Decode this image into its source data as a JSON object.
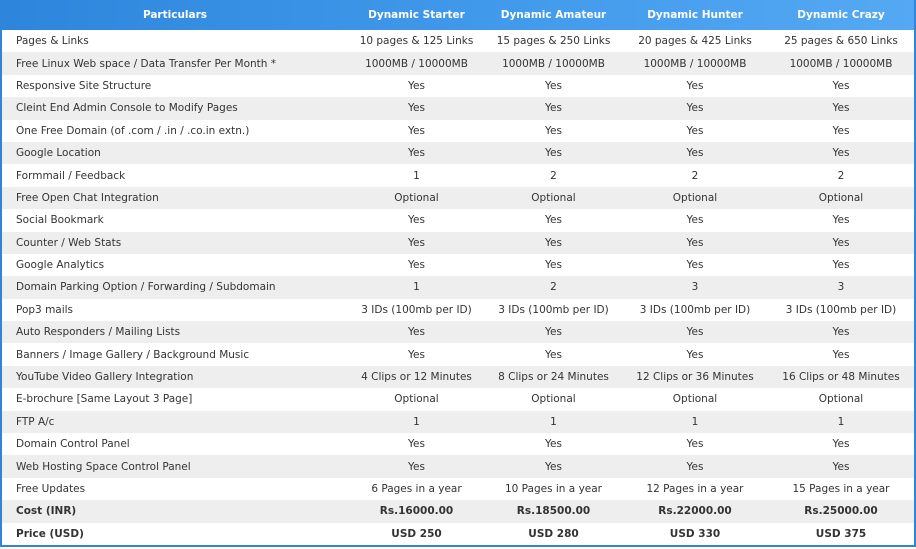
{
  "colors": {
    "header_bg": "#3a94e6",
    "border": "#2f86d9",
    "stripe": "#eeeeee"
  },
  "header": [
    "Particulars",
    "Dynamic Starter",
    "Dynamic Amateur",
    "Dynamic Hunter",
    "Dynamic Crazy"
  ],
  "rows": [
    {
      "label": "Pages & Links",
      "values": [
        "10 pages & 125 Links",
        "15 pages & 250 Links",
        "20 pages & 425 Links",
        "25 pages & 650 Links"
      ]
    },
    {
      "label": "Free Linux Web space / Data Transfer Per Month *",
      "values": [
        "1000MB / 10000MB",
        "1000MB / 10000MB",
        "1000MB / 10000MB",
        "1000MB / 10000MB"
      ]
    },
    {
      "label": "Responsive Site Structure",
      "values": [
        "Yes",
        "Yes",
        "Yes",
        "Yes"
      ]
    },
    {
      "label": "Cleint End Admin Console to Modify Pages",
      "values": [
        "Yes",
        "Yes",
        "Yes",
        "Yes"
      ]
    },
    {
      "label": "One Free Domain (of .com / .in / .co.in extn.)",
      "values": [
        "Yes",
        "Yes",
        "Yes",
        "Yes"
      ]
    },
    {
      "label": "Google Location",
      "values": [
        "Yes",
        "Yes",
        "Yes",
        "Yes"
      ]
    },
    {
      "label": "Formmail / Feedback",
      "values": [
        "1",
        "2",
        "2",
        "2"
      ]
    },
    {
      "label": "Free Open Chat Integration",
      "values": [
        "Optional",
        "Optional",
        "Optional",
        "Optional"
      ]
    },
    {
      "label": "Social Bookmark",
      "values": [
        "Yes",
        "Yes",
        "Yes",
        "Yes"
      ]
    },
    {
      "label": "Counter / Web Stats",
      "values": [
        "Yes",
        "Yes",
        "Yes",
        "Yes"
      ]
    },
    {
      "label": "Google Analytics",
      "values": [
        "Yes",
        "Yes",
        "Yes",
        "Yes"
      ]
    },
    {
      "label": "Domain Parking Option / Forwarding / Subdomain",
      "values": [
        "1",
        "2",
        "3",
        "3"
      ]
    },
    {
      "label": "Pop3 mails",
      "values": [
        "3 IDs (100mb per ID)",
        "3 IDs (100mb per ID)",
        "3 IDs (100mb per ID)",
        "3 IDs (100mb per ID)"
      ]
    },
    {
      "label": "Auto Responders / Mailing Lists",
      "values": [
        "Yes",
        "Yes",
        "Yes",
        "Yes"
      ]
    },
    {
      "label": "Banners / Image Gallery / Background Music",
      "values": [
        "Yes",
        "Yes",
        "Yes",
        "Yes"
      ]
    },
    {
      "label": "YouTube Video Gallery Integration",
      "values": [
        "4 Clips or 12 Minutes",
        "8 Clips or 24 Minutes",
        "12 Clips or 36 Minutes",
        "16 Clips or 48 Minutes"
      ]
    },
    {
      "label": "E-brochure [Same Layout 3 Page]",
      "values": [
        "Optional",
        "Optional",
        "Optional",
        "Optional"
      ]
    },
    {
      "label": "FTP A/c",
      "values": [
        "1",
        "1",
        "1",
        "1"
      ]
    },
    {
      "label": "Domain Control Panel",
      "values": [
        "Yes",
        "Yes",
        "Yes",
        "Yes"
      ]
    },
    {
      "label": "Web Hosting Space Control Panel",
      "values": [
        "Yes",
        "Yes",
        "Yes",
        "Yes"
      ]
    },
    {
      "label": "Free Updates",
      "values": [
        "6 Pages in a year",
        "10 Pages in a year",
        "12 Pages in a year",
        "15 Pages in a year"
      ]
    },
    {
      "label": "Cost (INR)",
      "values": [
        "Rs.16000.00",
        "Rs.18500.00",
        "Rs.22000.00",
        "Rs.25000.00"
      ],
      "bold": true
    },
    {
      "label": "Price (USD)",
      "values": [
        "USD 250",
        "USD 280",
        "USD 330",
        "USD 375"
      ],
      "bold": true
    }
  ]
}
